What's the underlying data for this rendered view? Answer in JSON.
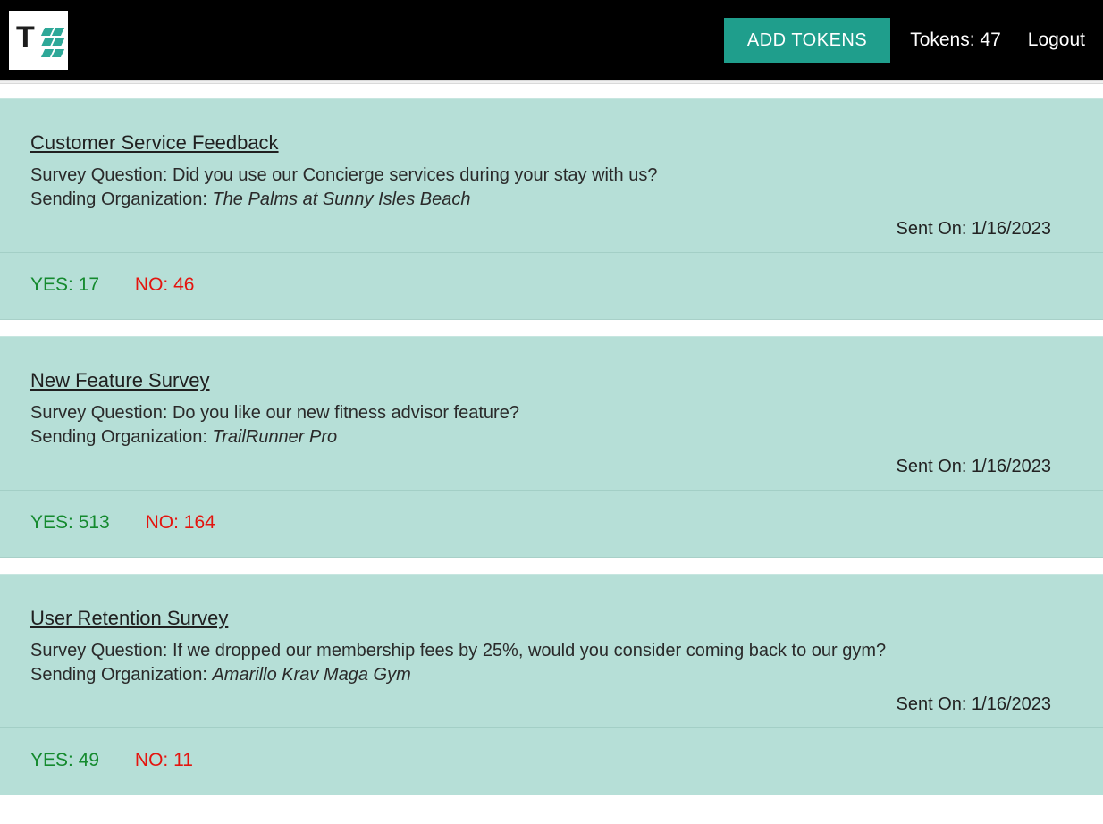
{
  "header": {
    "add_tokens_label": "ADD TOKENS",
    "tokens_prefix": "Tokens: ",
    "tokens_count": "47",
    "logout_label": "Logout"
  },
  "labels": {
    "survey_question": "Survey Question: ",
    "sending_org": "Sending Organization: ",
    "sent_on": "Sent On: ",
    "yes_prefix": "YES: ",
    "no_prefix": "NO: "
  },
  "cards": [
    {
      "title": "Customer Service Feedback",
      "question": "Did you use our Concierge services during your stay with us?",
      "org": "The Palms at Sunny Isles Beach",
      "sent_on": "1/16/2023",
      "yes": "17",
      "no": "46"
    },
    {
      "title": "New Feature Survey",
      "question": "Do you like our new fitness advisor feature?",
      "org": "TrailRunner Pro",
      "sent_on": "1/16/2023",
      "yes": "513",
      "no": "164"
    },
    {
      "title": "User Retention Survey",
      "question": "If we dropped our membership fees by 25%, would you consider coming back to our gym?",
      "org": "Amarillo Krav Maga Gym",
      "sent_on": "1/16/2023",
      "yes": "49",
      "no": "11"
    }
  ]
}
